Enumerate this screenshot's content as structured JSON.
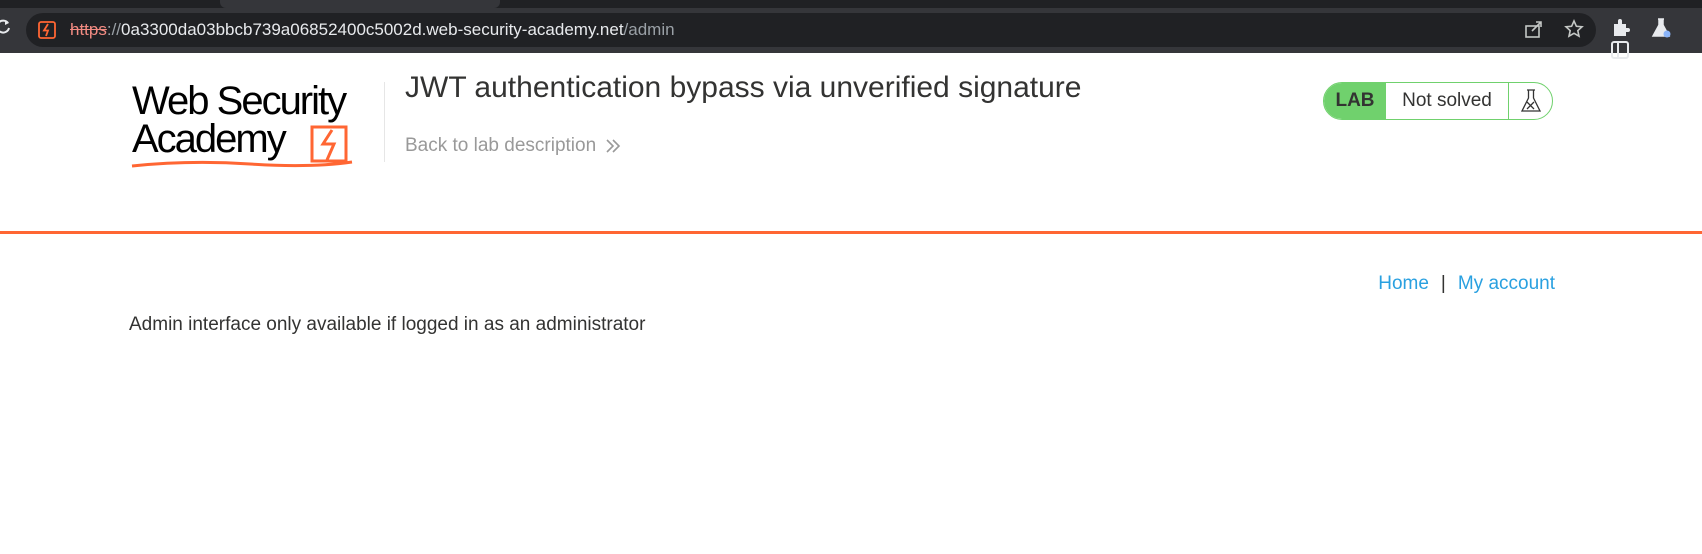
{
  "browser": {
    "url_scheme": "https",
    "url_separator": "://",
    "url_host": "0a3300da03bbcb739a06852400c5002d.web-security-academy.net",
    "url_path": "/admin",
    "icons": [
      "reload-icon",
      "site-info-icon",
      "share-icon",
      "bookmark-star-icon",
      "extensions-icon",
      "labs-flask-icon",
      "side-panel-icon"
    ]
  },
  "header": {
    "logo_line1": "Web Security",
    "logo_line2": "Academy",
    "lab_title": "JWT authentication bypass via unverified signature",
    "back_link": "Back to lab description"
  },
  "lab_status": {
    "badge": "LAB",
    "state": "Not solved",
    "accent_color": "#70d16d"
  },
  "nav": {
    "home": "Home",
    "separator": "|",
    "my_account": "My account"
  },
  "content": {
    "message": "Admin interface only available if logged in as an administrator"
  },
  "colors": {
    "brand_orange": "#ff6633",
    "link_blue": "#29a0e0"
  }
}
